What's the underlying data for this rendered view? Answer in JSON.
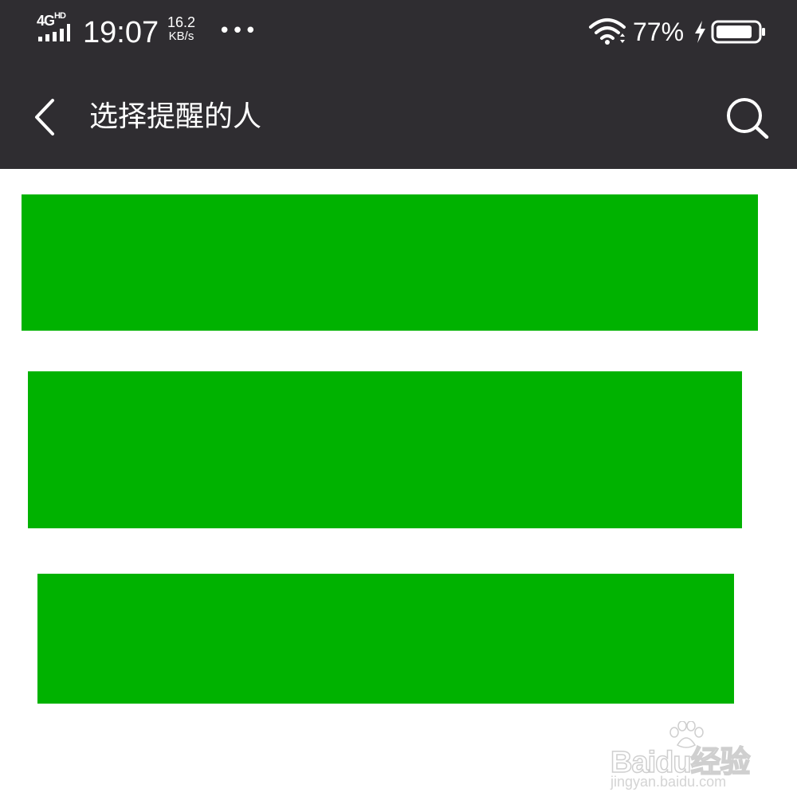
{
  "status_bar": {
    "network": "4G",
    "network_hd": "HD",
    "time": "19:07",
    "speed_value": "16.2",
    "speed_unit": "KB/s",
    "more": "•••",
    "battery_percent": "77%"
  },
  "nav": {
    "title": "选择提醒的人"
  },
  "content": {
    "blocks": [
      {
        "color": "#00b200"
      },
      {
        "color": "#00b200"
      },
      {
        "color": "#00b200"
      }
    ]
  },
  "watermark": {
    "brand": "Baidu经验",
    "url": "jingyan.baidu.com"
  },
  "colors": {
    "bar_background": "#2f2d31",
    "block_green": "#00b200",
    "page_background": "#ffffff"
  }
}
